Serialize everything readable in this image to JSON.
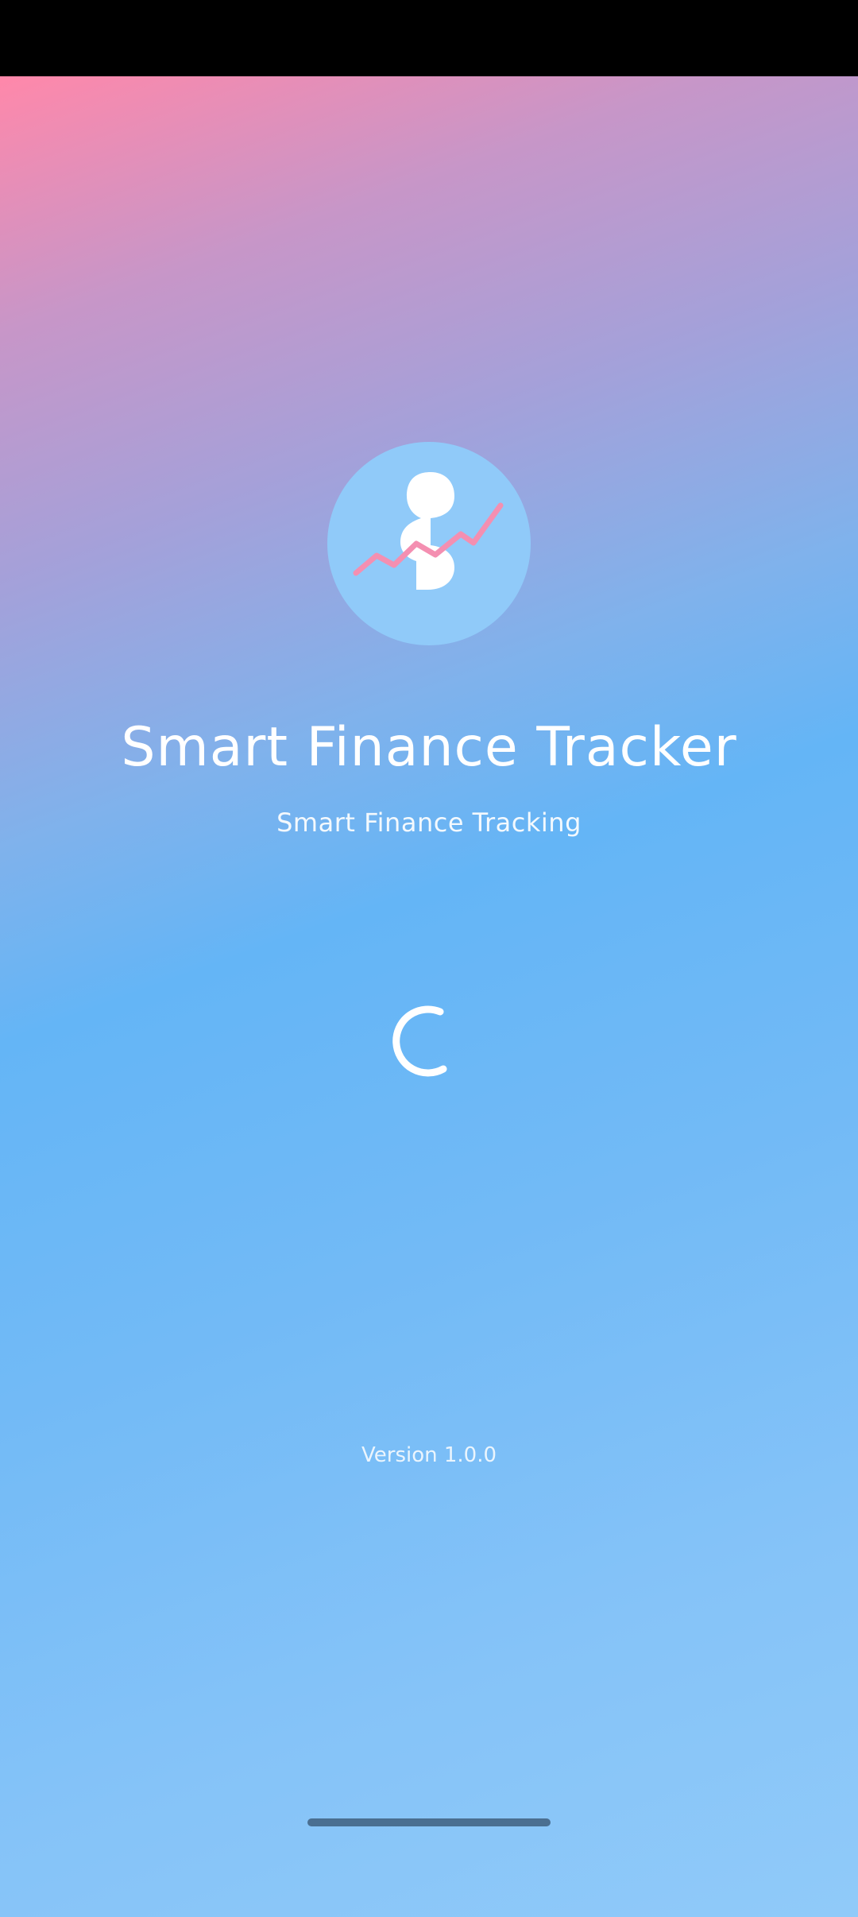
{
  "app": {
    "title": "Smart Finance Tracker",
    "subtitle": "Smart Finance Tracking",
    "version": "Version 1.0.0"
  },
  "logo": {
    "icon": "finance-logo-icon",
    "circle_color": "#90CAF9",
    "trend_line_color": "#F48FB1"
  },
  "loading": {
    "icon": "loading-spinner-icon",
    "color": "#FFFFFF"
  },
  "theme": {
    "gradient_top": "#FF88AA",
    "gradient_mid": "#64B5F6",
    "gradient_bottom": "#90CAF9",
    "status_bar": "#000000"
  }
}
